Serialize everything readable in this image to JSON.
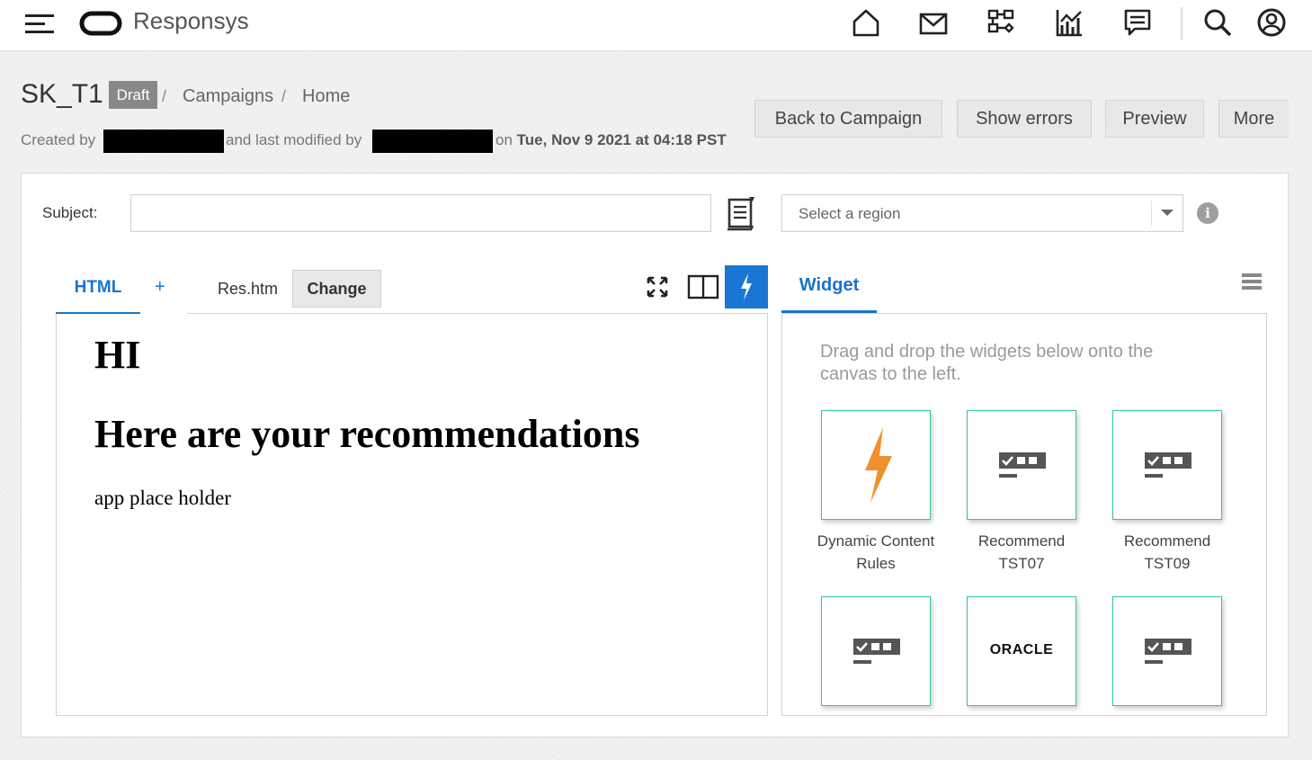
{
  "app": {
    "title": "Responsys"
  },
  "breadcrumb": {
    "title": "SK_T1",
    "badge": "Draft",
    "sep": "/",
    "items": [
      "Campaigns",
      "Home"
    ]
  },
  "meta": {
    "created_by_label": "Created by",
    "modified_by_label": "and last modified by",
    "on_label": "on",
    "date": "Tue, Nov 9 2021 at 04:18 PST"
  },
  "actions": {
    "back": "Back to Campaign",
    "errors": "Show errors",
    "preview": "Preview",
    "more": "More"
  },
  "subject": {
    "label": "Subject:",
    "value": ""
  },
  "region": {
    "placeholder": "Select a region"
  },
  "editor": {
    "tab_label": "HTML",
    "add_label": "+",
    "file_name": "Res.htm",
    "change_label": "Change",
    "content": {
      "h1": "HI",
      "h2": "Here are your recommendations",
      "p": "app place holder"
    }
  },
  "widgets": {
    "tab_label": "Widget",
    "hint": "Drag and drop the widgets below onto the canvas to the left.",
    "items": [
      {
        "label": "Dynamic Content Rules",
        "icon": "lightning-icon"
      },
      {
        "label": "Recommend TST07",
        "icon": "recommend-icon"
      },
      {
        "label": "Recommend TST09",
        "icon": "recommend-icon"
      },
      {
        "label": "",
        "icon": "recommend-icon"
      },
      {
        "label": "",
        "icon": "oracle-logo",
        "logo_text": "ORACLE"
      },
      {
        "label": "",
        "icon": "recommend-icon"
      }
    ]
  },
  "colors": {
    "accent": "#1976c9",
    "tile_border": "#33c4a4",
    "bolt_orange": "#f0902c"
  }
}
